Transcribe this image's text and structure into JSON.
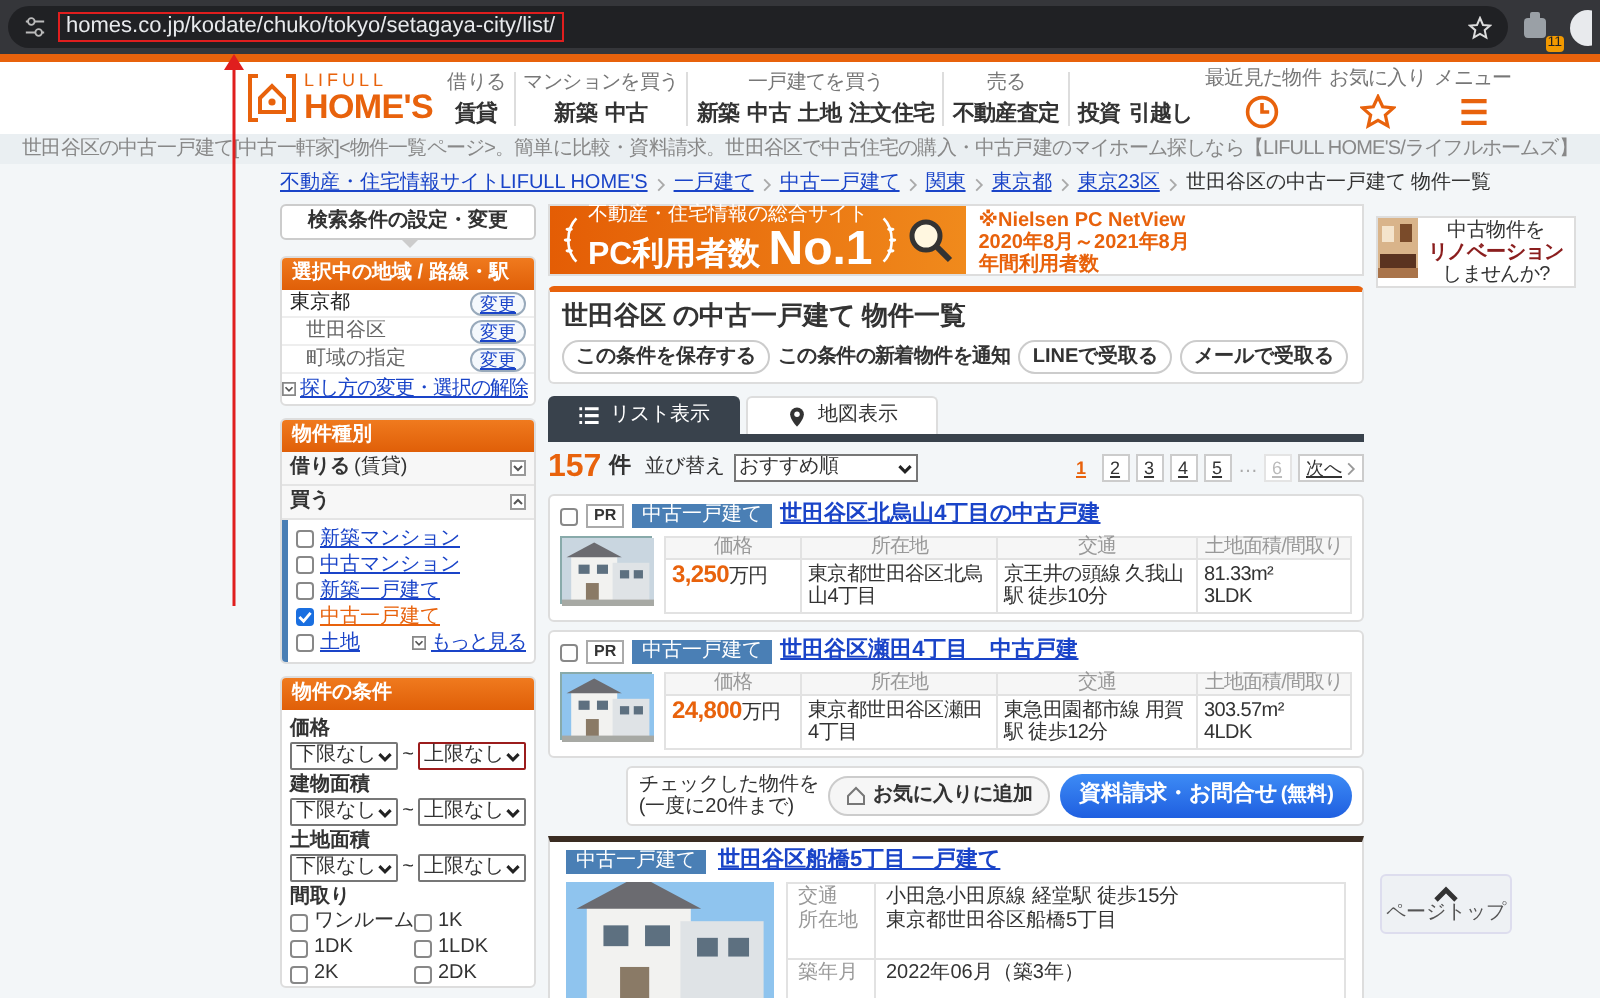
{
  "browser": {
    "url": "homes.co.jp/kodate/chuko/tokyo/setagaya-city/list/",
    "extension_badge": "11"
  },
  "annotations": {
    "url_box": true,
    "arrow": true
  },
  "header": {
    "logo_top": "LIFULL",
    "logo_bottom": "HOME'S",
    "nav": [
      {
        "label": "借りる",
        "links": [
          "賃貸"
        ]
      },
      {
        "label": "マンションを買う",
        "links": [
          "新築",
          "中古"
        ]
      },
      {
        "label": "一戸建てを買う",
        "links": [
          "新築",
          "中古",
          "土地",
          "注文住宅"
        ]
      },
      {
        "label": "売る",
        "links": [
          "不動産査定"
        ]
      },
      {
        "links": [
          "投資",
          "引越し"
        ]
      }
    ],
    "icons": [
      {
        "kind": "clock",
        "label": "最近見た物件"
      },
      {
        "kind": "star",
        "label": "お気に入り"
      },
      {
        "kind": "menu",
        "label": "メニュー"
      }
    ]
  },
  "description": "世田谷区の中古一戸建て[中古一軒家]<物件一覧ページ>。簡単に比較・資料請求。世田谷区で中古住宅の購入・中古戸建のマイホーム探しなら【LIFULL HOME'S/ライフルホームズ】",
  "breadcrumb": [
    {
      "label": "不動産・住宅情報サイトLIFULL HOME'S",
      "link": true
    },
    {
      "label": "一戸建て",
      "link": true
    },
    {
      "label": "中古一戸建て",
      "link": true
    },
    {
      "label": "関東",
      "link": true
    },
    {
      "label": "東京都",
      "link": true
    },
    {
      "label": "東京23区",
      "link": true
    },
    {
      "label": "世田谷区の中古一戸建て 物件一覧",
      "link": false
    }
  ],
  "sidebar": {
    "search_button": "検索条件の設定・変更",
    "area": {
      "title": "選択中の地域 / 路線・駅",
      "rows": [
        {
          "label": "東京都",
          "action": "変更",
          "indented": false
        },
        {
          "label": "世田谷区",
          "action": "変更",
          "indented": true
        },
        {
          "label": "町域の指定",
          "action": "変更",
          "indented": true
        }
      ],
      "reset_link": "探し方の変更・選択の解除"
    },
    "type": {
      "title": "物件種別",
      "groups": [
        {
          "label": "借りる",
          "note": "(賃貸)",
          "expanded": false
        },
        {
          "label": "買う",
          "expanded": true,
          "options": [
            {
              "label": "新築マンション",
              "checked": false
            },
            {
              "label": "中古マンション",
              "checked": false
            },
            {
              "label": "新築一戸建て",
              "checked": false
            },
            {
              "label": "中古一戸建て",
              "checked": true
            },
            {
              "label": "土地",
              "checked": false
            }
          ],
          "more": "もっと見る"
        }
      ]
    },
    "conditions": {
      "title": "物件の条件",
      "ranges": [
        {
          "label": "価格",
          "min": "下限なし",
          "max": "上限なし",
          "max_focused": true
        },
        {
          "label": "建物面積",
          "min": "下限なし",
          "max": "上限なし",
          "max_focused": false
        },
        {
          "label": "土地面積",
          "min": "下限なし",
          "max": "上限なし",
          "max_focused": false
        }
      ],
      "separator": "~",
      "layout_title": "間取り",
      "layouts": [
        {
          "label": "ワンルーム",
          "checked": false
        },
        {
          "label": "1K",
          "checked": false
        },
        {
          "label": "1DK",
          "checked": false
        },
        {
          "label": "1LDK",
          "checked": false
        },
        {
          "label": "2K",
          "checked": false
        },
        {
          "label": "2DK",
          "checked": false
        }
      ]
    }
  },
  "main": {
    "banner": {
      "tagline": "不動産・住宅情報の総合サイト",
      "headline": "PC利用者数",
      "rank": "No.1",
      "note_lines": [
        "※Nielsen PC NetView",
        "2020年8月～2021年8月",
        "年間利用者数"
      ]
    },
    "title": "世田谷区 の中古一戸建て 物件一覧",
    "actions": [
      {
        "kind": "button",
        "label": "この条件を保存する"
      },
      {
        "kind": "text",
        "label": "この条件の新着物件を通知"
      },
      {
        "kind": "button",
        "label": "LINEで受取る"
      },
      {
        "kind": "button",
        "label": "メールで受取る"
      }
    ],
    "view_tabs": [
      {
        "kind": "list",
        "label": "リスト表示",
        "selected": true
      },
      {
        "kind": "map",
        "label": "地図表示",
        "selected": false
      }
    ],
    "count": "157",
    "count_unit": "件",
    "sort_label": "並び替え",
    "sort_value": "おすすめ順",
    "pages": [
      {
        "kind": "page",
        "label": "1",
        "selected": true,
        "disabled": false
      },
      {
        "kind": "page",
        "label": "2",
        "selected": false,
        "disabled": false
      },
      {
        "kind": "page",
        "label": "3",
        "selected": false,
        "disabled": false
      },
      {
        "kind": "page",
        "label": "4",
        "selected": false,
        "disabled": false
      },
      {
        "kind": "page",
        "label": "5",
        "selected": false,
        "disabled": false
      },
      {
        "kind": "ellipsis",
        "label": "…"
      },
      {
        "kind": "page",
        "label": "6",
        "selected": false,
        "disabled": true
      },
      {
        "kind": "next",
        "label": "次へ"
      }
    ],
    "listings": [
      {
        "checked": false,
        "pr": "PR",
        "tag": "中古一戸建て",
        "title": "世田谷区北烏山4丁目の中古戸建",
        "columns": [
          "価格",
          "所在地",
          "交通",
          "土地面積/間取り"
        ],
        "price": "3,250",
        "price_unit": "万円",
        "address": "東京都世田谷区北烏山4丁目",
        "access": "京王井の頭線 久我山駅 徒歩10分",
        "area": "81.33m²",
        "layout": "3LDK"
      },
      {
        "checked": false,
        "pr": "PR",
        "tag": "中古一戸建て",
        "title": "世田谷区瀬田4丁目　中古戸建",
        "columns": [
          "価格",
          "所在地",
          "交通",
          "土地面積/間取り"
        ],
        "price": "24,800",
        "price_unit": "万円",
        "address": "東京都世田谷区瀬田4丁目",
        "access": "東急田園都市線 用賀駅 徒歩12分",
        "area": "303.57m²",
        "layout": "4LDK"
      }
    ],
    "bulk": {
      "note_lines": [
        "チェックした物件を",
        "(一度に20件まで)"
      ],
      "favorite": "お気に入りに追加",
      "inquiry": "資料請求・お問合せ",
      "inquiry_note": "(無料)"
    },
    "featured": {
      "tag": "中古一戸建て",
      "title": "世田谷区船橋5丁目 一戸建て",
      "rows": [
        {
          "labels": [
            "交通",
            "所在地"
          ],
          "values": [
            "小田急小田原線 経堂駅 徒歩15分",
            "東京都世田谷区船橋5丁目"
          ]
        },
        {
          "labels": [
            "築年月"
          ],
          "values": [
            "2022年06月（築3年）"
          ]
        }
      ]
    }
  },
  "side_ad": {
    "lines": [
      "中古物件を",
      "リノベーション",
      "しませんか?"
    ]
  },
  "page_top": "ページトップ"
}
